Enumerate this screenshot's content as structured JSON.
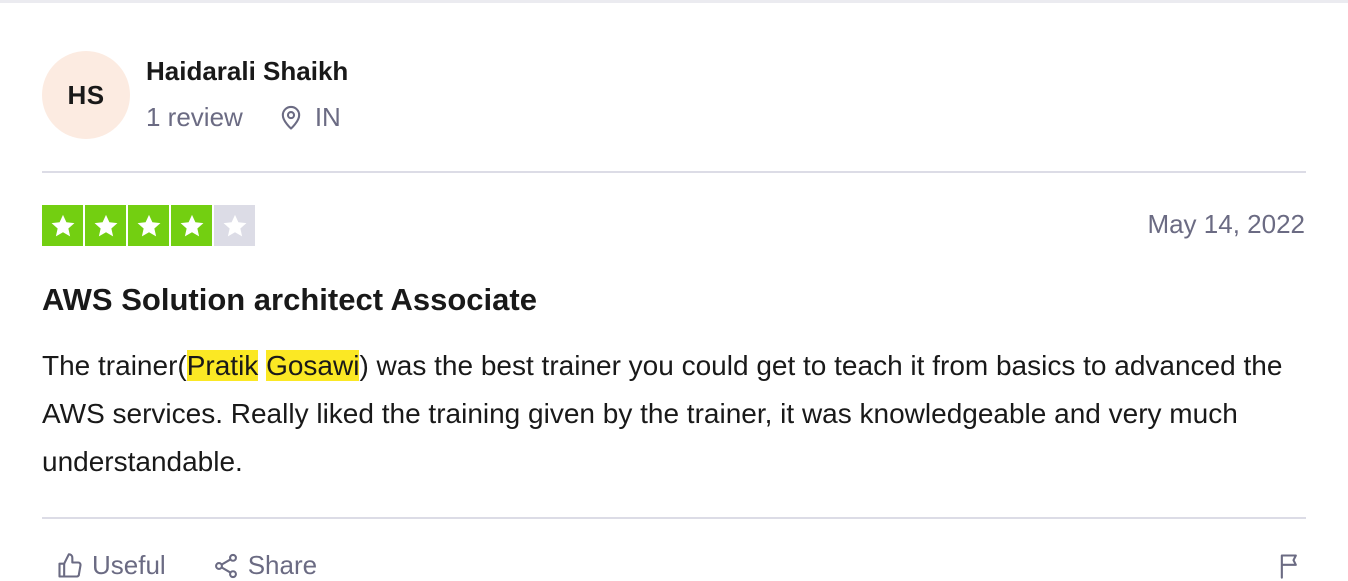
{
  "reviewer": {
    "initials": "HS",
    "name": "Haidarali Shaikh",
    "review_count": "1 review",
    "country": "IN"
  },
  "review": {
    "rating": 4,
    "max_rating": 5,
    "date": "May 14, 2022",
    "title": "AWS Solution architect Associate",
    "body": {
      "part1": "The trainer(",
      "highlight1": "Pratik",
      "space": " ",
      "highlight2": "Gosawi",
      "part2": ") was the best trainer you could get to teach it from basics to advanced the AWS services. Really liked the training given by the trainer, it was knowledgeable and very much understandable."
    }
  },
  "actions": {
    "useful_label": "Useful",
    "share_label": "Share"
  },
  "icons": {
    "location": "location-pin-icon",
    "star": "star-icon",
    "useful": "thumbs-up-icon",
    "share": "share-icon",
    "flag": "flag-icon"
  },
  "colors": {
    "star_filled": "#73cf11",
    "star_empty": "#dcdce6",
    "highlight": "#fbe824",
    "avatar_bg": "#fcebe1",
    "muted_text": "#6b6b83"
  }
}
